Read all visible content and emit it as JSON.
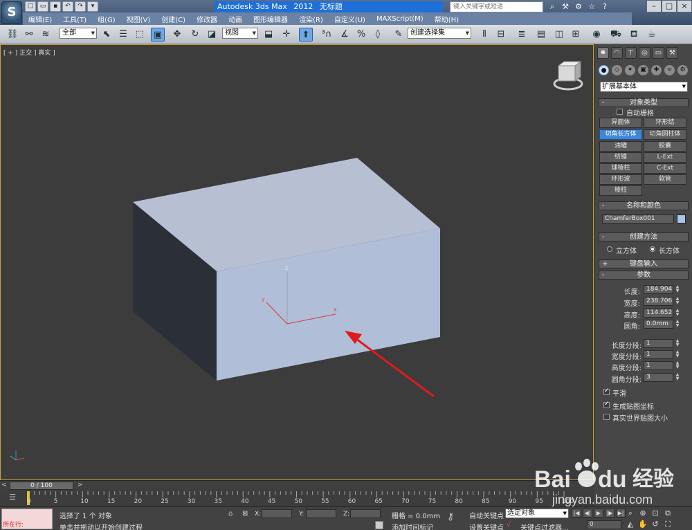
{
  "title_bar": {
    "app_name": "Autodesk 3ds Max",
    "version": "2012",
    "doc_name": "无标题",
    "search_placeholder": "键入关键字或短语"
  },
  "menu": [
    "编辑(E)",
    "工具(T)",
    "组(G)",
    "视图(V)",
    "创建(C)",
    "修改器",
    "动画",
    "图形编辑器",
    "渲染(R)",
    "自定义(U)",
    "MAXScript(M)",
    "帮助(H)"
  ],
  "main_toolbar": {
    "selection_filter": "全部",
    "reference_coord": "视图",
    "named_selection": "创建选择集"
  },
  "viewport": {
    "label": "[ + ] 正交 ] 真实 ]",
    "axis_labels": {
      "x": "x",
      "y": "y",
      "z": "z"
    }
  },
  "command_panel": {
    "category": "扩展基本体",
    "object_type": {
      "title": "对象类型",
      "autogrid_label": "自动栅格",
      "buttons": [
        "异面体",
        "环形结",
        "切角长方体",
        "切角圆柱体",
        "油罐",
        "胶囊",
        "纺锤",
        "L-Ext",
        "球棱柱",
        "C-Ext",
        "环形波",
        "软管",
        "棱柱"
      ],
      "active": "切角长方体"
    },
    "name_color": {
      "title": "名称和颜色",
      "name": "ChamferBox001",
      "swatch_color": "#a9c6e8"
    },
    "creation_method": {
      "title": "创建方法",
      "option_cube": "立方体",
      "option_box": "长方体",
      "selected": "长方体"
    },
    "keyboard_entry_title": "键盘输入",
    "parameters": {
      "title": "参数",
      "length_label": "长度:",
      "length": "184.904m",
      "width_label": "宽度:",
      "width": "238.706m",
      "height_label": "高度:",
      "height": "114.652m",
      "fillet_label": "圆角:",
      "fillet": "0.0mm",
      "length_segs_label": "长度分段:",
      "length_segs": "1",
      "width_segs_label": "宽度分段:",
      "width_segs": "1",
      "height_segs_label": "高度分段:",
      "height_segs": "1",
      "fillet_segs_label": "圆角分段:",
      "fillet_segs": "3",
      "smooth_label": "平滑",
      "gen_mapping_label": "生成贴图坐标",
      "real_world_label": "真实世界贴图大小"
    }
  },
  "timeline": {
    "frame_display": "0 / 100",
    "ticks": [
      "0",
      "5",
      "10",
      "15",
      "20",
      "25",
      "30",
      "35",
      "40",
      "45",
      "50",
      "55",
      "60",
      "65",
      "70",
      "75",
      "80",
      "85",
      "90",
      "95",
      "100"
    ]
  },
  "status_bar": {
    "maxscript_label": "所在行:",
    "selection_info": "选择了 1 个 对象",
    "prompt": "单击并拖动以开始创建过程",
    "x_label": "X:",
    "y_label": "Y:",
    "z_label": "Z:",
    "grid": "栅格 = 0.0mm",
    "add_time_tag": "添加时间标记",
    "auto_key": "自动关键点",
    "set_key": "设置关键点",
    "selection_set": "选定对象",
    "key_filters": "关键点过滤器...",
    "frame": "0"
  },
  "watermark": {
    "brand": "Bai",
    "brand2": "du",
    "cn": "经验",
    "url": "jingyan.baidu.com"
  },
  "colors": {
    "viewport_bg": "#3c3c3c",
    "box_top": "#b7c0d2",
    "box_front": "#b1bed8",
    "box_side": "#2b3038",
    "arrow": "#e0191b",
    "active_button": "#3f86d8"
  }
}
